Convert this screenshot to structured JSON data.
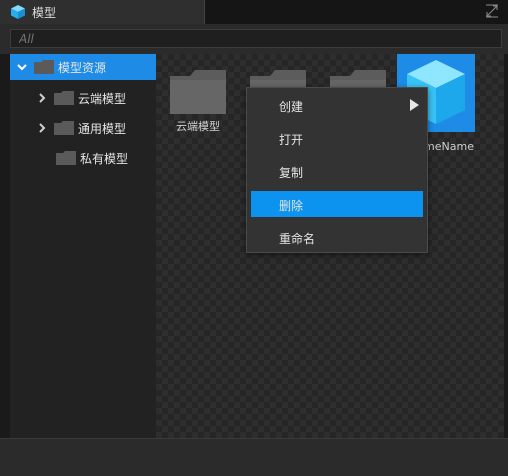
{
  "tab": {
    "title": "模型",
    "icon": "cube-icon"
  },
  "search": {
    "value": "",
    "placeholder": "All"
  },
  "tree": {
    "root": {
      "label": "模型资源",
      "expanded": true
    },
    "children": [
      {
        "label": "云端模型",
        "has_children": true
      },
      {
        "label": "通用模型",
        "has_children": true
      },
      {
        "label": "私有模型",
        "has_children": false
      }
    ]
  },
  "assets": [
    {
      "label": "云端模型",
      "type": "folder-icon"
    },
    {
      "label": "",
      "type": "folder-icon"
    },
    {
      "label": "",
      "type": "folder-icon"
    },
    {
      "label": "meName",
      "type": "cube-icon"
    }
  ],
  "context_menu": {
    "items": [
      {
        "label": "创建",
        "has_submenu": true
      },
      {
        "label": "打开"
      },
      {
        "label": "复制"
      },
      {
        "label": "删除",
        "highlighted": true
      },
      {
        "label": "重命名"
      }
    ]
  },
  "colors": {
    "accent": "#1e8ce6",
    "menu_highlight": "#0c93f0",
    "cube": "#39c6f7"
  }
}
